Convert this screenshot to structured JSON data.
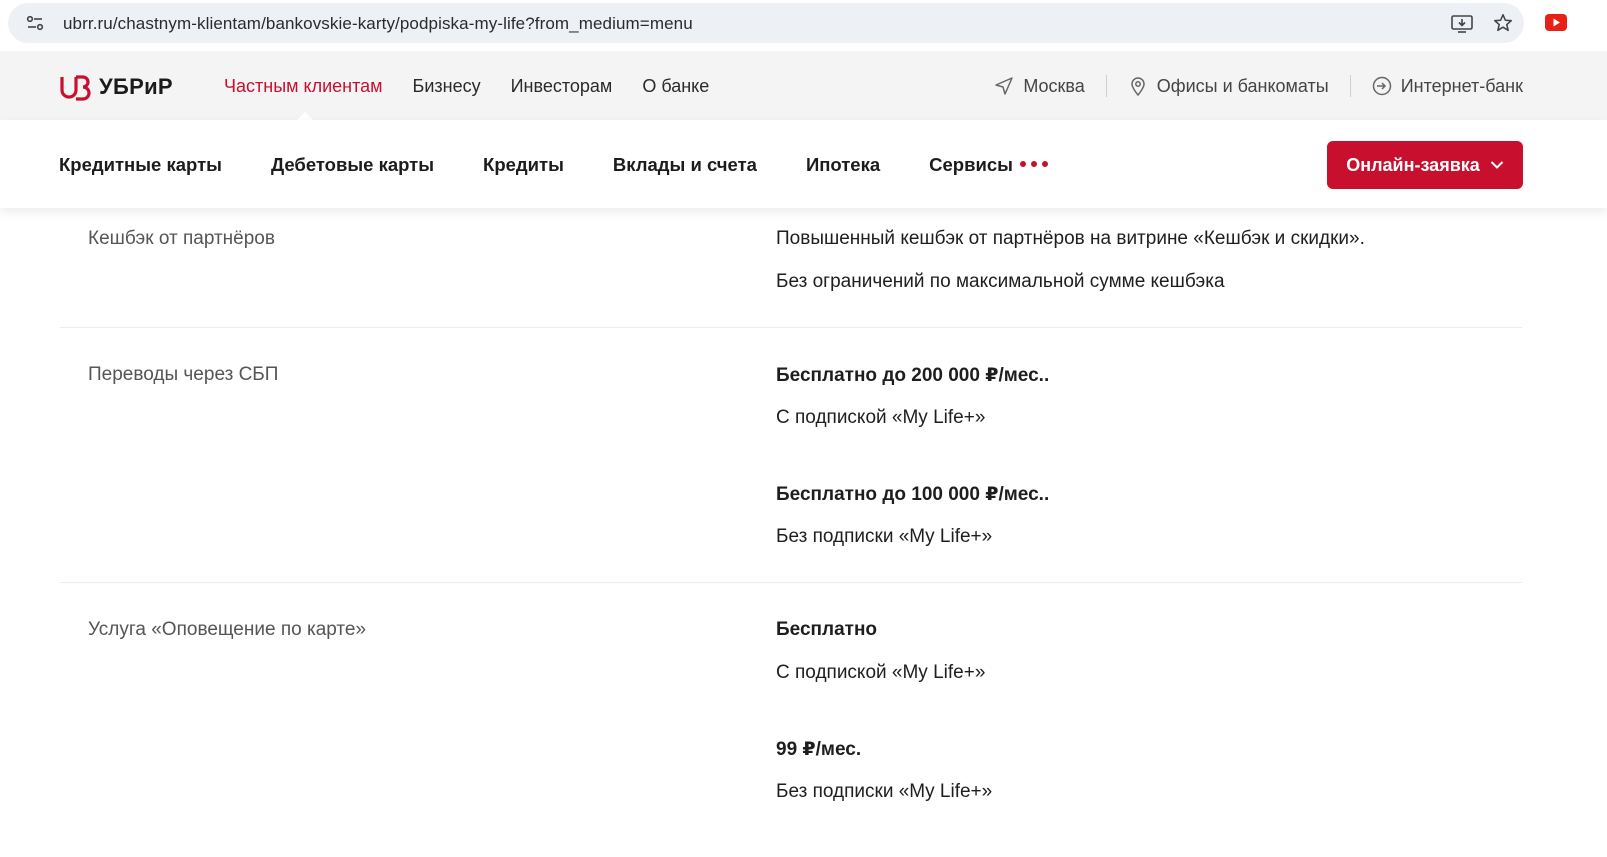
{
  "browser": {
    "url": "ubrr.ru/chastnym-klientam/bankovskie-karty/podpiska-my-life?from_medium=menu"
  },
  "header": {
    "logo_text": "УБРиР",
    "segments": [
      "Частным клиентам",
      "Бизнесу",
      "Инвесторам",
      "О банке"
    ],
    "city": "Москва",
    "offices": "Офисы и банкоматы",
    "internet_bank": "Интернет-банк"
  },
  "product_nav": {
    "items": [
      "Кредитные карты",
      "Дебетовые карты",
      "Кредиты",
      "Вклады и счета",
      "Ипотека",
      "Сервисы"
    ],
    "cta_label": "Онлайн-заявка"
  },
  "colors": {
    "accent": "#c8102e"
  },
  "rows": [
    {
      "label": "Кешбэк от партнёров",
      "lines": [
        "Повышенный кешбэк от партнёров на витрине «Кешбэк и скидки».",
        "Без ограничений по максимальной сумме кешбэка"
      ]
    },
    {
      "label": "Переводы через СБП",
      "lines": [
        "Бесплатно до 200 000 ₽/мес..",
        "С подпиской «My Life+»",
        "Бесплатно до 100 000 ₽/мес..",
        "Без подписки «My Life+»"
      ]
    },
    {
      "label": "Услуга «Оповещение по карте»",
      "lines": [
        "Бесплатно",
        "С подпиской «My Life+»",
        "99 ₽/мес.",
        "Без подписки «My Life+»"
      ]
    }
  ]
}
